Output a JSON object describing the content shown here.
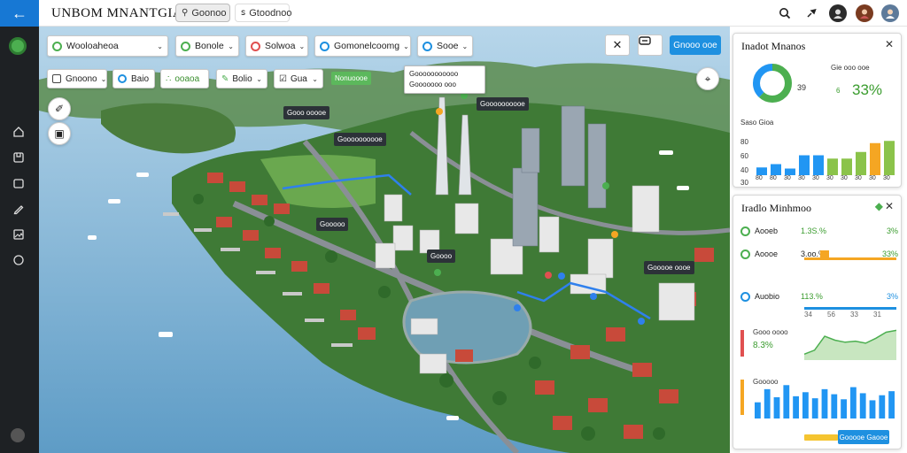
{
  "app": {
    "title": "UNBOM MNANTGIA",
    "tabs": [
      {
        "label": "Goonoo",
        "icon": "search-icon",
        "active": true
      },
      {
        "label": "Gtoodnoo",
        "icon": "s-icon",
        "active": false
      }
    ]
  },
  "filters": [
    {
      "label": "Wooloaheoa",
      "color": "#4caf50"
    },
    {
      "label": "Bonole",
      "color": "#4caf50"
    },
    {
      "label": "Solwoa",
      "color": "#e05050"
    },
    {
      "label": "Gomonelcoomg",
      "color": "#1e90e0"
    },
    {
      "label": "Sooe",
      "color": "#1e90e0"
    }
  ],
  "filters_row2": [
    {
      "label": "Gnoono",
      "icon": "grid-icon",
      "green": false
    },
    {
      "label": "Baio",
      "icon": "info-icon",
      "green": false
    },
    {
      "label": "ooaoa",
      "icon": "green-dots-icon",
      "green": true
    },
    {
      "label": "Bolio",
      "icon": "edit-icon",
      "green": false
    },
    {
      "label": "Gua",
      "icon": "check-icon",
      "green": false
    }
  ],
  "map_toolbar": {
    "primary_button": "Gnooo ooe"
  },
  "map": {
    "labels": [
      {
        "text": "Nonuoooe",
        "style": "green"
      },
      {
        "text": "Gooo ooooe",
        "style": "dark"
      },
      {
        "text": "Goooooooooe",
        "style": "dark"
      },
      {
        "text": "Goooooooooe",
        "style": "dark"
      },
      {
        "text": "Gooooo",
        "style": "dark"
      },
      {
        "text": "Goooo",
        "style": "dark"
      },
      {
        "text": "Gooooe oooe",
        "style": "dark"
      }
    ],
    "tooltip_lines": [
      "Gooooooooooo",
      "Gooooooo ooo"
    ]
  },
  "panel1": {
    "title": "Inadot Mnanos",
    "donut_label": "39",
    "stat_caption": "Gie ooo ooe",
    "stat_value": "33%",
    "stat_prefix": "6",
    "chart_title": "Saso Gioa",
    "y_labels": [
      "80",
      "60",
      "40",
      "30"
    ],
    "x_labels": [
      "80",
      "80",
      "30",
      "30",
      "30",
      "30",
      "30",
      "30",
      "30",
      "30"
    ]
  },
  "panel2": {
    "title": "Iradlo Minhmoo",
    "rows": [
      {
        "name": "Aooeb",
        "value": "1.3S.%",
        "pct": "3%",
        "color": "#4caf50"
      },
      {
        "name": "Aoooe",
        "value": "3.oo.%",
        "pct": "33%",
        "color": "#4caf50"
      },
      {
        "name": "Auobio",
        "value": "113.%",
        "pct": "3%",
        "color": "#1e90e0"
      }
    ],
    "axis_labels": [
      "34",
      "56",
      "33",
      "31",
      "80"
    ],
    "chart3_label": "Gooo oooo",
    "chart3_value": "8.3%",
    "chart4_label": "Gooooo",
    "footer_button": "Gooooe Gaooe"
  },
  "colors": {
    "accent": "#1e90e0",
    "sidebar": "#1e2124",
    "green": "#4caf50",
    "orange": "#f5a623",
    "blue_bar": "#2196f3"
  },
  "chart_data": [
    {
      "type": "bar",
      "title": "Saso Gioa",
      "categories": [
        "80",
        "80",
        "30",
        "30",
        "30",
        "30",
        "30",
        "30",
        "30",
        "30"
      ],
      "series": [
        {
          "values": [
            14,
            20,
            12,
            36,
            36,
            30,
            30,
            42,
            58,
            62
          ]
        }
      ],
      "ylim": [
        0,
        80
      ]
    },
    {
      "type": "area",
      "title": "",
      "x": [
        0,
        1,
        2,
        3,
        4,
        5,
        6,
        7,
        8,
        9
      ],
      "series": [
        {
          "values": [
            6,
            10,
            24,
            20,
            18,
            19,
            17,
            22,
            28,
            30
          ]
        }
      ]
    },
    {
      "type": "bar",
      "title": "",
      "categories": [
        "1",
        "2",
        "3",
        "4",
        "5",
        "6",
        "7",
        "8",
        "9",
        "10",
        "11",
        "12",
        "13",
        "14",
        "15"
      ],
      "series": [
        {
          "values": [
            32,
            58,
            42,
            66,
            44,
            52,
            40,
            58,
            48,
            38,
            62,
            50,
            36,
            46,
            54
          ]
        }
      ]
    }
  ]
}
